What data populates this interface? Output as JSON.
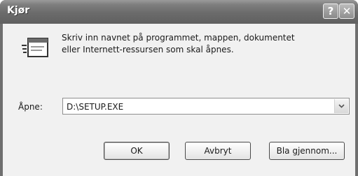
{
  "window": {
    "title": "Kjør",
    "help_glyph": "?",
    "close_glyph": "✕"
  },
  "dialog": {
    "icon": "run-icon",
    "description_line1": "Skriv inn navnet på programmet, mappen, dokumentet",
    "description_line2": "eller Internett-ressursen som skal åpnes.",
    "open_label": "Åpne:",
    "open_value": "D:\\SETUP.EXE"
  },
  "buttons": {
    "ok": "OK",
    "cancel": "Avbryt",
    "browse": "Bla gjennom..."
  }
}
